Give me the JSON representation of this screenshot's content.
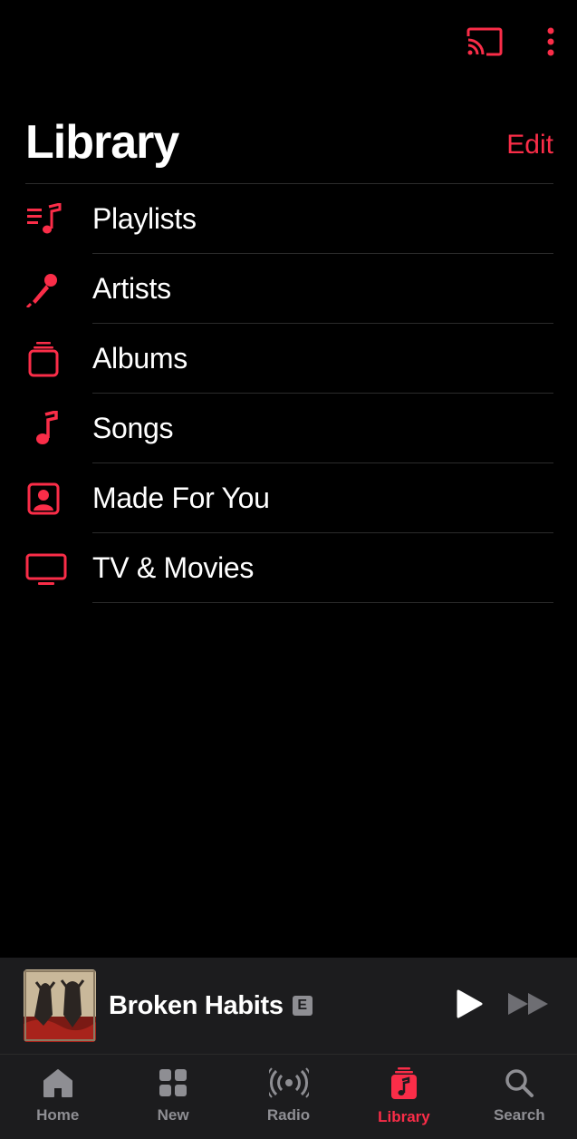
{
  "colors": {
    "accent": "#fa2d48",
    "background": "#000000",
    "bar": "#1c1c1e",
    "inactive": "#8e8e93"
  },
  "top_actions": {
    "icons": [
      "cast-icon",
      "more-vertical-icon"
    ]
  },
  "header": {
    "title": "Library",
    "edit_label": "Edit"
  },
  "library_items": [
    {
      "label": "Playlists",
      "icon": "playlist-icon"
    },
    {
      "label": "Artists",
      "icon": "microphone-icon"
    },
    {
      "label": "Albums",
      "icon": "album-stack-icon"
    },
    {
      "label": "Songs",
      "icon": "music-note-icon"
    },
    {
      "label": "Made For You",
      "icon": "person-square-icon"
    },
    {
      "label": "TV & Movies",
      "icon": "tv-icon"
    }
  ],
  "mini_player": {
    "title": "Broken Habits",
    "explicit_badge": "E"
  },
  "tabs": [
    {
      "label": "Home",
      "icon": "house-icon",
      "active": false
    },
    {
      "label": "New",
      "icon": "grid-icon",
      "active": false
    },
    {
      "label": "Radio",
      "icon": "radio-waves-icon",
      "active": false
    },
    {
      "label": "Library",
      "icon": "library-icon",
      "active": true
    },
    {
      "label": "Search",
      "icon": "search-icon",
      "active": false
    }
  ]
}
